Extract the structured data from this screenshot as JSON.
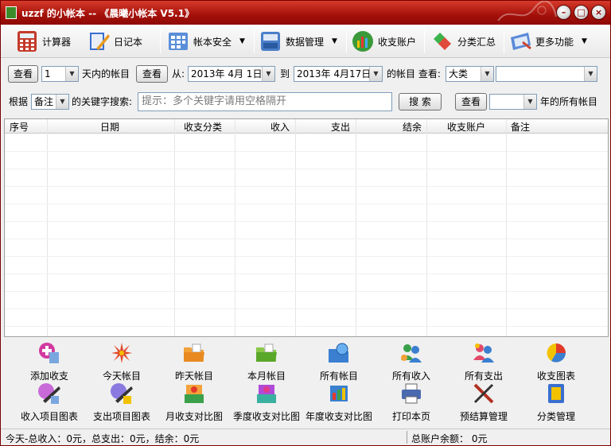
{
  "window": {
    "title": "uzzf 的小帐本 -- 《晨曦小帐本 V5.1》",
    "controls": {
      "minimize": "–",
      "maximize": "□",
      "close": "×"
    }
  },
  "toolbar": {
    "items": [
      {
        "label": "计算器",
        "icon": "calculator-icon"
      },
      {
        "label": "日记本",
        "icon": "notebook-icon"
      },
      {
        "label": "帐本安全",
        "icon": "security-icon"
      },
      {
        "label": "数据管理",
        "icon": "database-icon"
      },
      {
        "label": "收支账户",
        "icon": "account-icon"
      },
      {
        "label": "分类汇总",
        "icon": "summary-icon"
      },
      {
        "label": "更多功能",
        "icon": "more-icon"
      }
    ]
  },
  "query": {
    "view_button": "查看",
    "days_value": "1",
    "days_label": "天内的帐目",
    "from_label": "从:",
    "from_date": "2013年  4月  1日",
    "to_label": "到",
    "to_date": "2013年  4月17日",
    "of_accounts_label": "的帐目 查看:",
    "category_value": "大类",
    "category_detail": "",
    "search_by_label": "根据",
    "search_field_value": "备注",
    "keyword_label": "的关键字搜索:",
    "keyword_placeholder": "提示：多个关键字请用空格隔开",
    "search_button": "搜 索",
    "year_value": "",
    "year_label": "年的所有帐目"
  },
  "table": {
    "columns": [
      "序号",
      "日期",
      "收支分类",
      "收入",
      "支出",
      "结余",
      "收支账户",
      "备注"
    ],
    "rows": []
  },
  "actions": {
    "row1": [
      {
        "label": "添加收支",
        "icon": "add-entry-icon"
      },
      {
        "label": "今天帐目",
        "icon": "today-icon"
      },
      {
        "label": "昨天帐目",
        "icon": "yesterday-folder-icon"
      },
      {
        "label": "本月帐目",
        "icon": "month-folder-icon"
      },
      {
        "label": "所有帐目",
        "icon": "all-accounts-icon"
      },
      {
        "label": "所有收入",
        "icon": "all-income-icon"
      },
      {
        "label": "所有支出",
        "icon": "all-expense-icon"
      },
      {
        "label": "收支图表",
        "icon": "pie-chart-icon"
      }
    ],
    "row2": [
      {
        "label": "收入项目图表",
        "icon": "income-chart-icon"
      },
      {
        "label": "支出项目图表",
        "icon": "expense-chart-icon"
      },
      {
        "label": "月收支对比图",
        "icon": "month-compare-icon"
      },
      {
        "label": "季度收支对比图",
        "icon": "quarter-compare-icon"
      },
      {
        "label": "年度收支对比图",
        "icon": "year-compare-icon"
      },
      {
        "label": "打印本页",
        "icon": "print-icon"
      },
      {
        "label": "预结算管理",
        "icon": "budget-icon"
      },
      {
        "label": "分类管理",
        "icon": "category-manage-icon"
      }
    ]
  },
  "status": {
    "today_summary": "今天-总收入：0元，总支出：0元，结余：0元",
    "total_balance": "总账户余额： 0元"
  }
}
